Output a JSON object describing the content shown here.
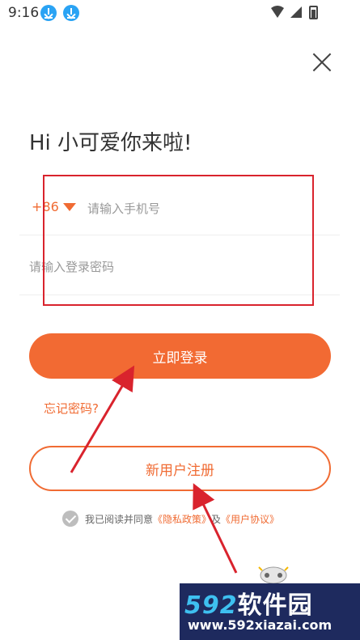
{
  "status_bar": {
    "time": "9:16"
  },
  "close_label": "✕",
  "greeting": "Hi 小可爱你来啦!",
  "phone": {
    "country_code": "+86",
    "placeholder": "请输入手机号"
  },
  "password": {
    "placeholder": "请输入登录密码"
  },
  "login_label": "立即登录",
  "forgot_label": "忘记密码?",
  "register_label": "新用户注册",
  "agreement": {
    "prefix": "我已阅读并同意",
    "privacy_link": "《隐私政策》",
    "connector": "及",
    "user_link": "《用户协议》"
  },
  "watermark": {
    "numbers": "592",
    "brand": "软件园",
    "url": "www.592xiazai.com"
  },
  "colors": {
    "accent": "#f26a33",
    "annotation_red": "#d9232d",
    "watermark_bg": "#1e2a5e"
  }
}
